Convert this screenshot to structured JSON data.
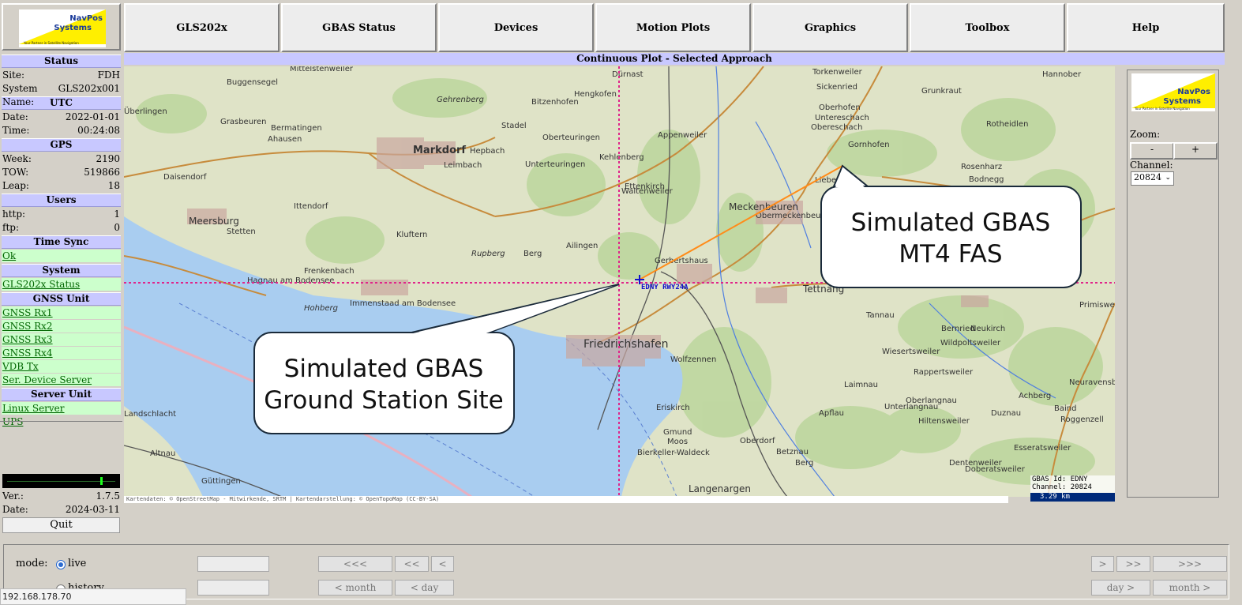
{
  "logo": {
    "line1": "NavPos",
    "line2": "Systems",
    "tagline": "Your Partner in Satellite Navigation"
  },
  "nav": [
    "GLS202x",
    "GBAS Status",
    "Devices",
    "Motion Plots",
    "Graphics",
    "Toolbox",
    "Help"
  ],
  "left": {
    "status_h": "Status",
    "site_label": "Site:",
    "site": "FDH",
    "sysname_label": "System Name:",
    "sysname": "GLS202x001",
    "utc_h": "UTC",
    "date_label": "Date:",
    "date": "2022-01-01",
    "time_label": "Time:",
    "time": "00:24:08",
    "gps_h": "GPS",
    "week_label": "Week:",
    "week": "2190",
    "tow_label": "TOW:",
    "tow": "519866",
    "leap_label": "Leap:",
    "leap": "18",
    "users_h": "Users",
    "http_label": "http:",
    "http": "1",
    "ftp_label": "ftp:",
    "ftp": "0",
    "timesync_h": "Time Sync",
    "timesync": "Ok",
    "system_h": "System",
    "system_link": "GLS202x Status",
    "gnss_h": "GNSS Unit",
    "gnss_links": [
      "GNSS Rx1",
      "GNSS Rx2",
      "GNSS Rx3",
      "GNSS Rx4",
      "VDB Tx",
      "Ser. Device Server"
    ],
    "server_h": "Server Unit",
    "server_links": [
      "Linux Server",
      "UPS"
    ],
    "ver_label": "Ver.:",
    "ver": "1.7.5",
    "vdate_label": "Date:",
    "vdate": "2024-03-11",
    "quit": "Quit"
  },
  "map": {
    "title": "Continuous Plot - Selected Approach",
    "callout1": [
      "Simulated GBAS",
      "MT4 FAS"
    ],
    "callout2": [
      "Simulated GBAS",
      "Ground Station Site"
    ],
    "station_label": "EDNY RWY24A",
    "places": [
      "Mittelstenweiler",
      "Buggensegel",
      "Überlingen",
      "Grasbeuren",
      "Bermatingen",
      "Ahausen",
      "Markdorf",
      "Hepbach",
      "Leimbach",
      "Stadel",
      "Bitzenhofen",
      "Oberteuringen",
      "Unterteuringen",
      "Kehlenberg",
      "Appenweiler",
      "Ettenkirch",
      "Waltenweiler",
      "Meckenbeuren",
      "Obermeckenbeuren",
      "Liebenau",
      "Tettnang",
      "Sickenried",
      "Oberhofen",
      "Untereschach",
      "Obereschach",
      "Gornhofen",
      "Grunkraut",
      "Rotheidlen",
      "Bodnegg",
      "Rosenharz",
      "Hannober",
      "Torkenweiler",
      "Dürnast",
      "Hengkofen",
      "Gehrenberg",
      "Daisendorf",
      "Meersburg",
      "Stetten",
      "Ittendorf",
      "Kluftern",
      "Ailingen",
      "Berg",
      "Rupberg",
      "Frenkenbach",
      "Hagnau am Bodensee",
      "Immenstaad am Bodensee",
      "Hohberg",
      "Friedrichshafen",
      "Gerbertshaus",
      "Wolfzennen",
      "Tannau",
      "Bernried",
      "Neukirch",
      "Wildpoltsweiler",
      "Wiesertsweiler",
      "Rappertsweiler",
      "Laimnau",
      "Achberg",
      "Oberlangnau",
      "Unterlangnau",
      "Hiltensweiler",
      "Apflau",
      "Duznau",
      "Roggenzell",
      "Eriskirch",
      "Gmund",
      "Moos",
      "Oberdorf",
      "Betznau",
      "Bierkeller-Waldeck",
      "Langenargen",
      "Berg",
      "Dentenweiler",
      "Doberatsweiler",
      "Esseratsweiler",
      "Altnau",
      "Güttingen",
      "Landschlacht",
      "Primisweiler",
      "Neuravensburg",
      "Baind"
    ],
    "credit": "Kartendaten: © OpenStreetMap - Mitwirkende, SRTM | Kartendarstellung: © OpenTopoMap (CC-BY-SA)",
    "gbas_id": "GBAS Id: EDNY",
    "channel": "Channel: 20824",
    "scale": "3.29 km"
  },
  "right": {
    "zoom_label": "Zoom:",
    "zoom_out": "-",
    "zoom_in": "+",
    "channel_label": "Channel:",
    "channel": "20824"
  },
  "bottom": {
    "mode_label": "mode:",
    "live": "live",
    "history": "history",
    "btn_far_back": "<<<",
    "btn_back": "<<",
    "btn_step_back": "<",
    "btn_step_fwd": ">",
    "btn_fwd": ">>",
    "btn_far_fwd": ">>>",
    "btn_month_back": "< month",
    "btn_day_back": "< day",
    "btn_day_fwd": "day >",
    "btn_month_fwd": "month >"
  },
  "statusbar": "192.168.178.70",
  "colors": {
    "nav_bg": "#ededed",
    "section_bg": "#c8c8ff",
    "link_bg": "#ccffcc",
    "approach_line": "#ff8c1a",
    "crosshair": "#e0248a",
    "water": "#a9cdf0"
  }
}
